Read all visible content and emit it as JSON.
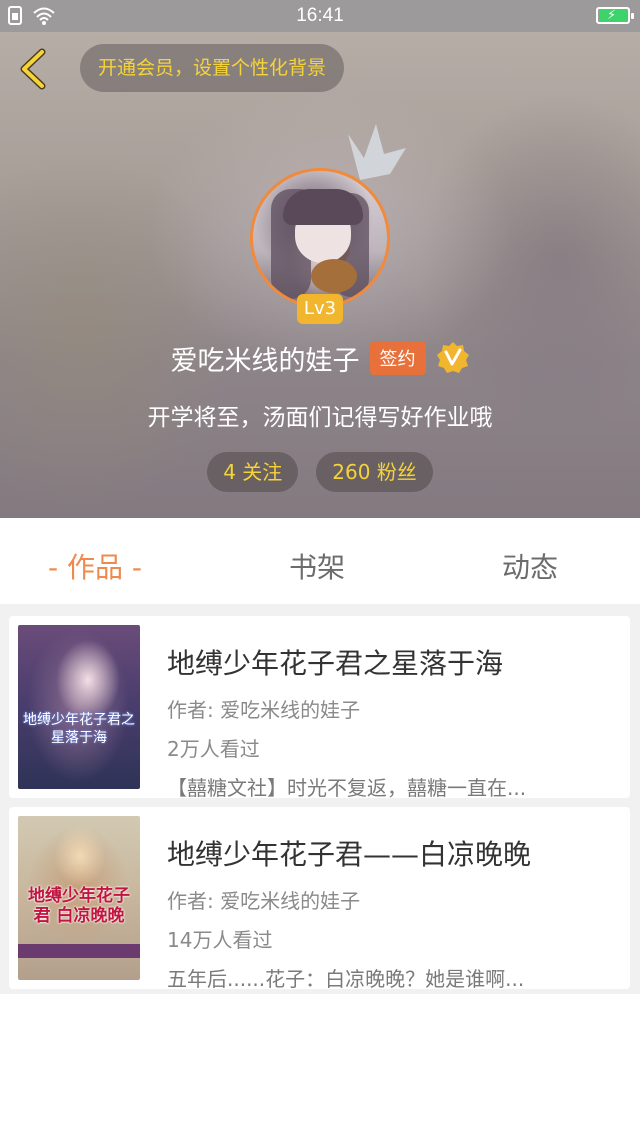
{
  "status_bar": {
    "time": "16:41",
    "icons": [
      "sim-icon",
      "wifi-icon",
      "battery-charging-icon"
    ]
  },
  "header": {
    "back_icon": "chevron-left-icon",
    "member_banner": "开通会员，设置个性化背景",
    "level": "Lv3",
    "username": "爱吃米线的娃子",
    "signed_badge": "签约",
    "verified_icon": "v-verified-icon",
    "bio": "开学将至，汤面们记得写好作业哦",
    "stats": [
      {
        "label": "4 关注"
      },
      {
        "label": "260 粉丝"
      }
    ],
    "colors": {
      "accent_yellow": "#f5d33b",
      "avatar_ring": "#f08a3c",
      "signed_orange": "#e8703a",
      "level_gold": "#f1b52e"
    }
  },
  "tabs": [
    {
      "label": "- 作品 -",
      "active": true
    },
    {
      "label": "书架",
      "active": false
    },
    {
      "label": "动态",
      "active": false
    }
  ],
  "books": [
    {
      "title": "地缚少年花子君之星落于海",
      "author": "作者: 爱吃米线的娃子",
      "views": "2万人看过",
      "description": "【囍糖文社】时光不复返，囍糖一直在...",
      "cover_text": "地缚少年花子君之星落于海"
    },
    {
      "title": "地缚少年花子君——白凉晚晚",
      "author": "作者: 爱吃米线的娃子",
      "views": "14万人看过",
      "description": "五年后......花子：白凉晚晚？她是谁啊...",
      "cover_text": "地缚少年花子君 白凉晚晚"
    }
  ]
}
